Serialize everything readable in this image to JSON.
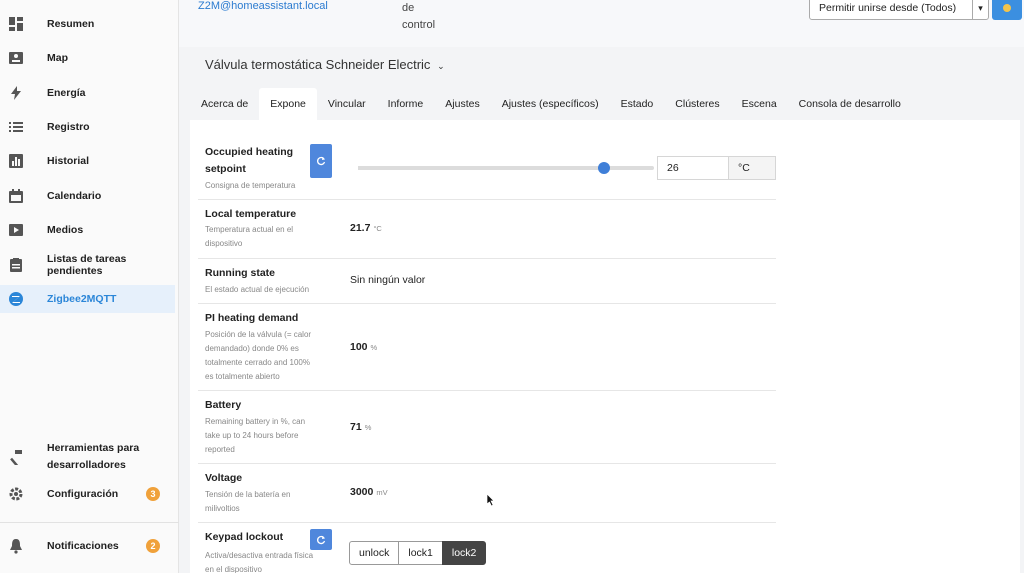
{
  "sidebar": {
    "items": [
      {
        "label": "Resumen",
        "icon": "dashboard-icon"
      },
      {
        "label": "Map",
        "icon": "map-icon"
      },
      {
        "label": "Energía",
        "icon": "lightning-icon"
      },
      {
        "label": "Registro",
        "icon": "list-icon"
      },
      {
        "label": "Historial",
        "icon": "chart-icon"
      },
      {
        "label": "Calendario",
        "icon": "calendar-icon"
      },
      {
        "label": "Medios",
        "icon": "media-icon"
      },
      {
        "label": "Listas de tareas pendientes",
        "icon": "clipboard-icon"
      },
      {
        "label": "Zigbee2MQTT",
        "icon": "zigbee-icon"
      }
    ],
    "dev_tools_line1": "Herramientas para",
    "dev_tools_line2": "desarrolladores",
    "config_label": "Configuración",
    "config_badge": "3",
    "notifications_label": "Notificaciones",
    "notifications_badge": "2"
  },
  "topbar": {
    "host": "Z2M@homeassistant.local",
    "control_line1": "de",
    "control_line2": "control",
    "permit_label": "Permitir unirse desde (Todos)"
  },
  "device": {
    "title": "Válvula termostática Schneider Electric"
  },
  "tabs": [
    "Acerca de",
    "Expone",
    "Vincular",
    "Informe",
    "Ajustes",
    "Ajustes (específicos)",
    "Estado",
    "Clústeres",
    "Escena",
    "Consola de desarrollo"
  ],
  "active_tab": "Expone",
  "exposes": {
    "setpoint": {
      "name_line1": "Occupied heating",
      "name_line2": "setpoint",
      "desc": "Consigna de temperatura",
      "value": "26",
      "unit": "°C",
      "slider_fraction": 0.83
    },
    "local_temp": {
      "name": "Local temperature",
      "desc_line1": "Temperatura actual en el",
      "desc_line2": "dispositivo",
      "value": "21.7",
      "unit": "°C"
    },
    "running_state": {
      "name": "Running state",
      "desc": "El estado actual de ejecución",
      "value": "Sin ningún valor"
    },
    "pi_demand": {
      "name": "PI heating demand",
      "desc_line1": "Posición de la válvula (= calor",
      "desc_line2": "demandado) donde 0% es",
      "desc_line3": "totalmente cerrado and 100%",
      "desc_line4": "es totalmente abierto",
      "value": "100",
      "unit": "%"
    },
    "battery": {
      "name": "Battery",
      "desc_line1": "Remaining battery in %, can",
      "desc_line2": "take up to 24 hours before",
      "desc_line3": "reported",
      "value": "71",
      "unit": "%"
    },
    "voltage": {
      "name": "Voltage",
      "desc_line1": "Tensión de la batería en",
      "desc_line2": "milivoltios",
      "value": "3000",
      "unit": "mV"
    },
    "keypad": {
      "name": "Keypad lockout",
      "desc_line1": "Activa/desactiva entrada física",
      "desc_line2": "en el dispositivo",
      "options": [
        "unlock",
        "lock1",
        "lock2"
      ],
      "selected": "lock2"
    }
  },
  "colors": {
    "accent": "#3f7fd8",
    "active_nav_bg": "#e6f0fb",
    "badge": "#f0a13a"
  }
}
